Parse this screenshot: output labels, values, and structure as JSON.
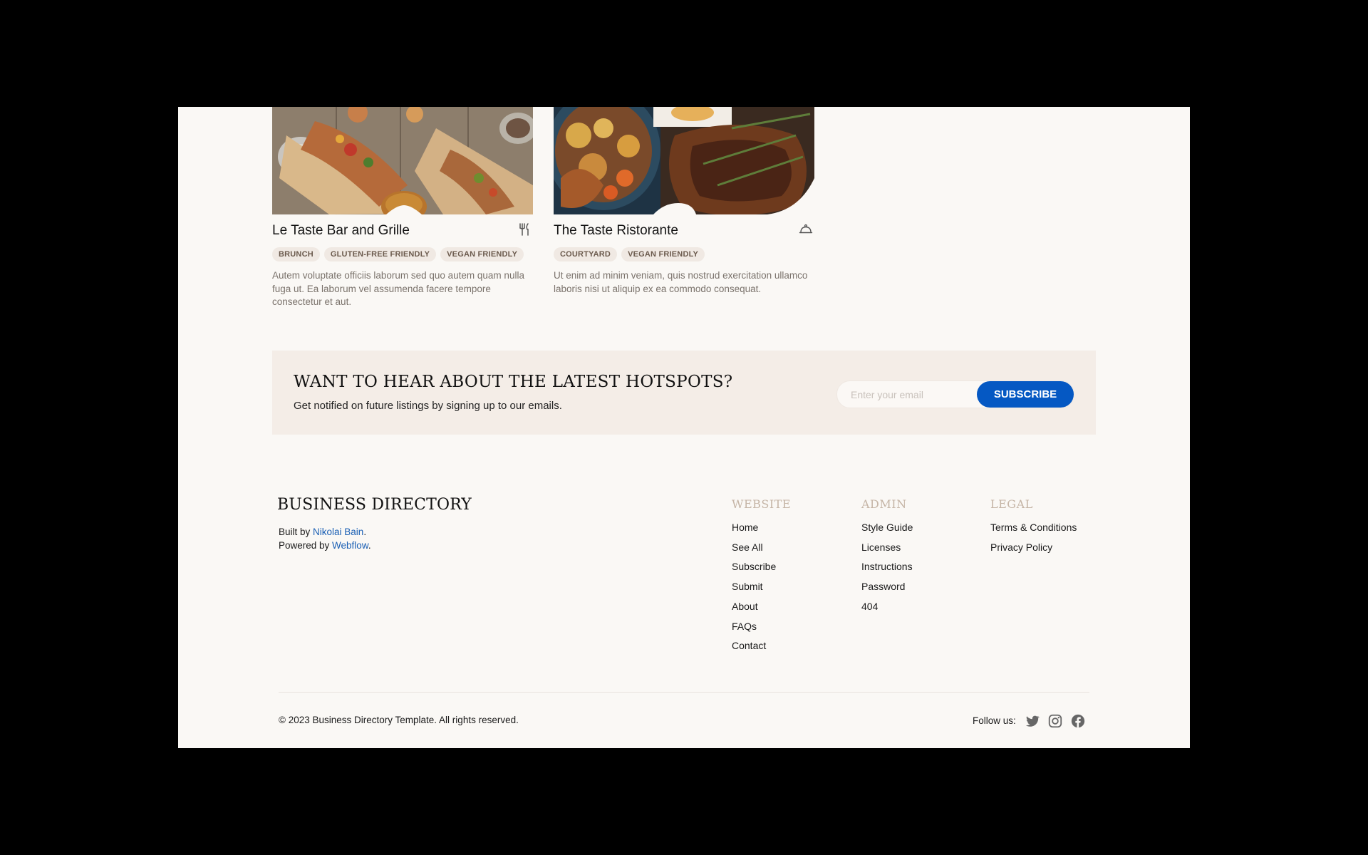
{
  "cards": [
    {
      "title": "Le Taste Bar and Grille",
      "icon": "utensils-icon",
      "tags": [
        "BRUNCH",
        "GLUTEN-FREE FRIENDLY",
        "VEGAN FRIENDLY"
      ],
      "description": "Autem voluptate officiis laborum sed quo autem quam nulla fuga ut. Ea laborum vel assumenda facere tempore consectetur et aut."
    },
    {
      "title": "The Taste Ristorante",
      "icon": "cloche-icon",
      "tags": [
        "COURTYARD",
        "VEGAN FRIENDLY"
      ],
      "description": "Ut enim ad minim veniam, quis nostrud exercitation ullamco laboris nisi ut aliquip ex ea commodo consequat."
    }
  ],
  "newsletter": {
    "heading": "WANT TO HEAR ABOUT THE LATEST HOTSPOTS?",
    "subheading": "Get notified on future listings by signing up to our emails.",
    "email_placeholder": "Enter your email",
    "button_label": "SUBSCRIBE"
  },
  "footer": {
    "brand": "BUSINESS DIRECTORY",
    "built_by_prefix": "Built by ",
    "built_by_name": "Nikolai Bain",
    "powered_by_prefix": "Powered by ",
    "powered_by_name": "Webflow",
    "period": ".",
    "columns": [
      {
        "title": "WEBSITE",
        "links": [
          "Home",
          "See All",
          "Subscribe",
          "Submit",
          "About",
          "FAQs",
          "Contact"
        ]
      },
      {
        "title": "ADMIN",
        "links": [
          "Style Guide",
          "Licenses",
          "Instructions",
          "Password",
          "404"
        ]
      },
      {
        "title": "LEGAL",
        "links": [
          "Terms & Conditions",
          "Privacy Policy"
        ]
      }
    ],
    "copyright": "© 2023 Business Directory Template. All rights reserved.",
    "follow_label": "Follow us:",
    "social_icons": [
      "twitter-icon",
      "instagram-icon",
      "facebook-icon"
    ]
  },
  "colors": {
    "accent": "#0558c3",
    "page_bg": "#faf8f5",
    "newsletter_bg": "#f4ede7",
    "tag_bg": "#f0e9e3",
    "column_title": "#c5b5a6"
  }
}
